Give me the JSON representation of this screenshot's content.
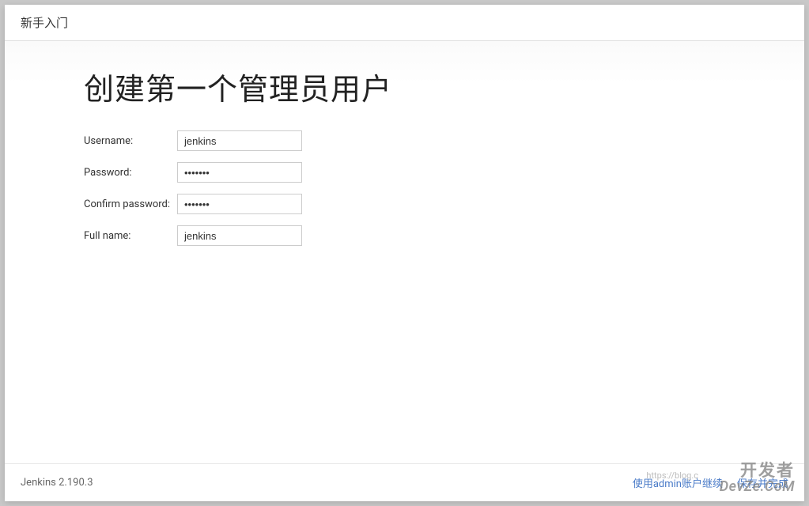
{
  "header": {
    "title": "新手入门"
  },
  "main": {
    "heading": "创建第一个管理员用户",
    "form": {
      "username": {
        "label": "Username:",
        "value": "jenkins"
      },
      "password": {
        "label": "Password:",
        "value": "•••••••"
      },
      "confirm": {
        "label": "Confirm password:",
        "value": "•••••••"
      },
      "fullname": {
        "label": "Full name:",
        "value": "jenkins"
      }
    }
  },
  "footer": {
    "version": "Jenkins 2.190.3",
    "continue_as_admin": "使用admin账户继续",
    "save_and_finish": "保存并完成"
  },
  "watermark": {
    "line1": "开发者",
    "line2": "DevZe.CoM",
    "sub": "https://blog.c"
  }
}
